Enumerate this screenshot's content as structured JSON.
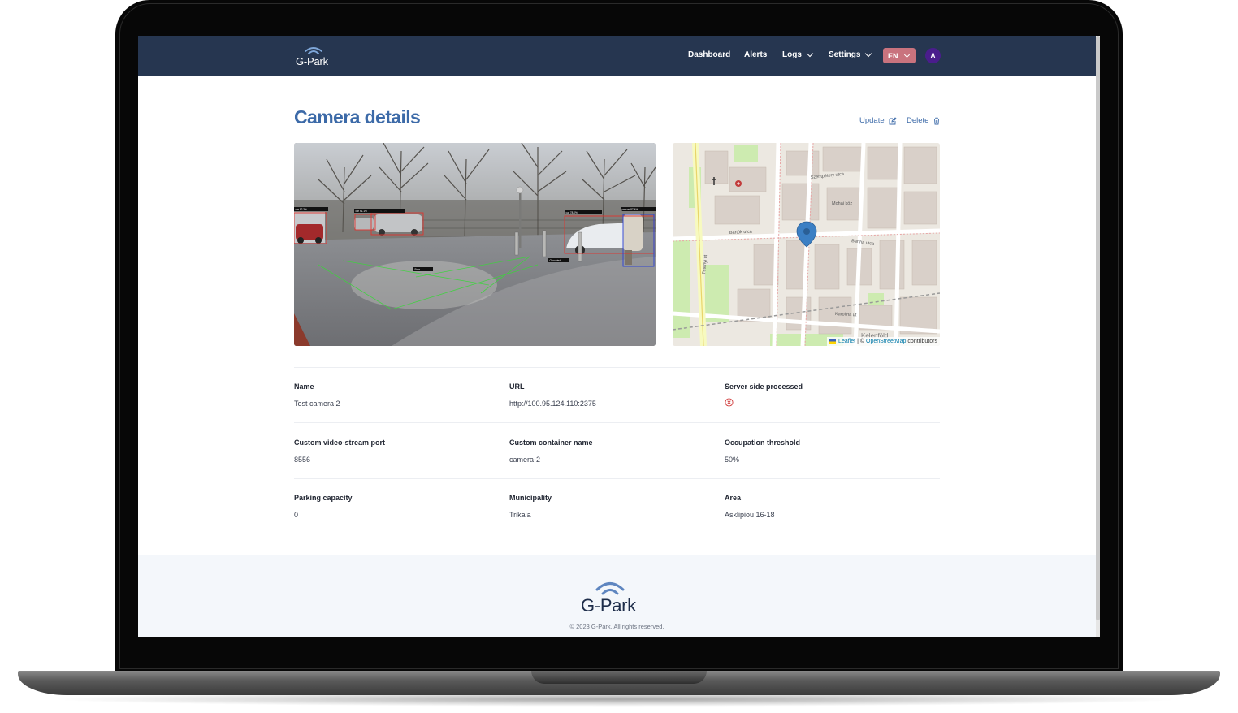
{
  "nav": {
    "brand": "G-Park",
    "links": [
      {
        "label": "Dashboard"
      },
      {
        "label": "Alerts"
      },
      {
        "label": "Logs"
      },
      {
        "label": "Settings"
      }
    ],
    "language": "EN",
    "avatar_initial": "A"
  },
  "header": {
    "title": "Camera details",
    "update_label": "Update",
    "delete_label": "Delete"
  },
  "camera_view": {
    "labels": [
      "car 82.3%",
      "car 91.1%",
      "car 78.0%",
      "person 87.4%",
      "Occupied",
      "Free"
    ]
  },
  "map": {
    "streets": [
      "Szentpétery utca",
      "Mohai köz",
      "Bartók utca",
      "Bartha utca",
      "Tétényi út",
      "Kelenföld",
      "Karolina út"
    ],
    "attribution": {
      "leaflet": "Leaflet",
      "separator": "| ©",
      "osm": "OpenStreetMap",
      "suffix": "contributors"
    }
  },
  "details": [
    [
      {
        "label": "Name",
        "value": "Test camera 2"
      },
      {
        "label": "URL",
        "value": "http://100.95.124.110:2375"
      },
      {
        "label": "Server side processed",
        "value": null,
        "icon": "x-circle-icon"
      }
    ],
    [
      {
        "label": "Custom video-stream port",
        "value": "8556"
      },
      {
        "label": "Custom container name",
        "value": "camera-2"
      },
      {
        "label": "Occupation threshold",
        "value": "50%"
      }
    ],
    [
      {
        "label": "Parking capacity",
        "value": "0"
      },
      {
        "label": "Municipality",
        "value": "Trikala"
      },
      {
        "label": "Area",
        "value": "Asklipiou 16-18"
      }
    ]
  ],
  "footer": {
    "brand": "G-Park",
    "copyright": "© 2023 G-Park, All rights reserved."
  },
  "colors": {
    "nav_bg": "#263650",
    "accent": "#3c6aa8",
    "lang_badge": "#c9737e",
    "avatar": "#4a1d8c",
    "footer_bg": "#f4f7fb"
  }
}
